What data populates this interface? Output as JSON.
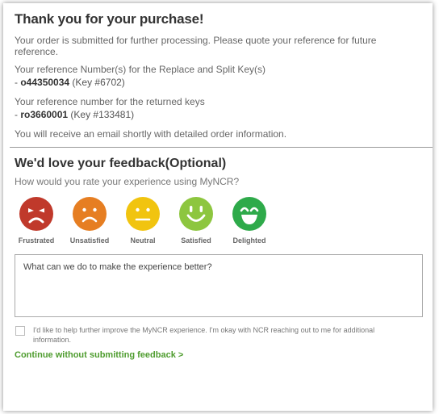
{
  "confirmation": {
    "title": "Thank you for your purchase!",
    "submitted_message": "Your order is submitted for further processing. Please quote your reference for future reference.",
    "replace_split_label": "Your reference Number(s) for the Replace and Split Key(s)",
    "replace_split_ref": "o44350034",
    "replace_split_key": "(Key #6702)",
    "returned_label": "Your reference number for the returned keys",
    "returned_ref": "ro3660001",
    "returned_key": "(Key #133481)",
    "email_message": "You will receive an email shortly with detailed order information."
  },
  "feedback": {
    "title": "We'd love your feedback(Optional)",
    "question": "How would you rate your experience using MyNCR?",
    "ratings": [
      {
        "label": "Frustrated",
        "icon": "frustrated-face-icon",
        "color": "#c0392b"
      },
      {
        "label": "Unsatisfied",
        "icon": "unsatisfied-face-icon",
        "color": "#e67e22"
      },
      {
        "label": "Neutral",
        "icon": "neutral-face-icon",
        "color": "#f1c40f"
      },
      {
        "label": "Satisfied",
        "icon": "satisfied-face-icon",
        "color": "#8dc63f"
      },
      {
        "label": "Delighted",
        "icon": "delighted-face-icon",
        "color": "#2eaa4a"
      }
    ],
    "comment_placeholder": "What can we do to make the experience better?",
    "consent_text": "I'd like to help further improve the MyNCR experience. I'm okay with NCR reaching out to me for additional information.",
    "continue_link": "Continue without submitting feedback >"
  }
}
